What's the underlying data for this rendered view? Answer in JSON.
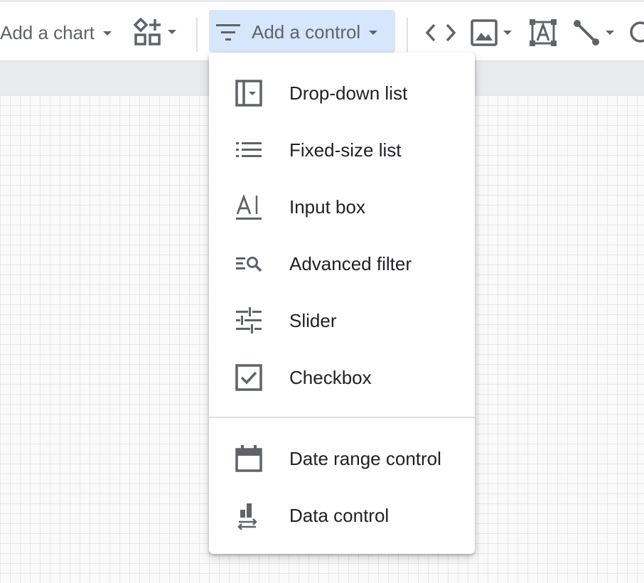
{
  "toolbar": {
    "add_chart_label": "Add a chart",
    "add_control_label": "Add a control",
    "items": [
      {
        "name": "community-visualizations-icon"
      },
      {
        "name": "embed-code-icon"
      },
      {
        "name": "image-icon"
      },
      {
        "name": "text-icon"
      },
      {
        "name": "line-icon"
      },
      {
        "name": "shape-icon"
      }
    ]
  },
  "menu": {
    "items": [
      {
        "label": "Drop-down list",
        "icon": "dropdown-list-icon"
      },
      {
        "label": "Fixed-size list",
        "icon": "list-icon"
      },
      {
        "label": "Input box",
        "icon": "input-box-icon"
      },
      {
        "label": "Advanced filter",
        "icon": "advanced-filter-icon"
      },
      {
        "label": "Slider",
        "icon": "slider-icon"
      },
      {
        "label": "Checkbox",
        "icon": "checkbox-icon"
      }
    ],
    "secondary_items": [
      {
        "label": "Date range control",
        "icon": "calendar-icon"
      },
      {
        "label": "Data control",
        "icon": "data-control-icon"
      }
    ]
  },
  "colors": {
    "icon": "#5f6368",
    "menu_text": "#202124",
    "active_button_bg": "#d7e6fb",
    "canvas_grid": "#e6e6e6"
  }
}
